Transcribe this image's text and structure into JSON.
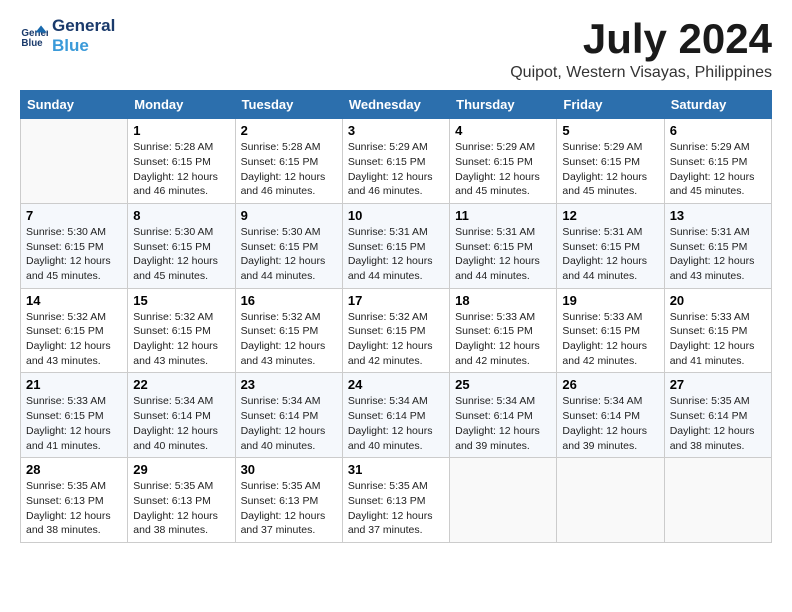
{
  "header": {
    "logo_line1": "General",
    "logo_line2": "Blue",
    "month_year": "July 2024",
    "location": "Quipot, Western Visayas, Philippines"
  },
  "columns": [
    "Sunday",
    "Monday",
    "Tuesday",
    "Wednesday",
    "Thursday",
    "Friday",
    "Saturday"
  ],
  "weeks": [
    [
      {
        "day": "",
        "info": ""
      },
      {
        "day": "1",
        "info": "Sunrise: 5:28 AM\nSunset: 6:15 PM\nDaylight: 12 hours\nand 46 minutes."
      },
      {
        "day": "2",
        "info": "Sunrise: 5:28 AM\nSunset: 6:15 PM\nDaylight: 12 hours\nand 46 minutes."
      },
      {
        "day": "3",
        "info": "Sunrise: 5:29 AM\nSunset: 6:15 PM\nDaylight: 12 hours\nand 46 minutes."
      },
      {
        "day": "4",
        "info": "Sunrise: 5:29 AM\nSunset: 6:15 PM\nDaylight: 12 hours\nand 45 minutes."
      },
      {
        "day": "5",
        "info": "Sunrise: 5:29 AM\nSunset: 6:15 PM\nDaylight: 12 hours\nand 45 minutes."
      },
      {
        "day": "6",
        "info": "Sunrise: 5:29 AM\nSunset: 6:15 PM\nDaylight: 12 hours\nand 45 minutes."
      }
    ],
    [
      {
        "day": "7",
        "info": "Sunrise: 5:30 AM\nSunset: 6:15 PM\nDaylight: 12 hours\nand 45 minutes."
      },
      {
        "day": "8",
        "info": "Sunrise: 5:30 AM\nSunset: 6:15 PM\nDaylight: 12 hours\nand 45 minutes."
      },
      {
        "day": "9",
        "info": "Sunrise: 5:30 AM\nSunset: 6:15 PM\nDaylight: 12 hours\nand 44 minutes."
      },
      {
        "day": "10",
        "info": "Sunrise: 5:31 AM\nSunset: 6:15 PM\nDaylight: 12 hours\nand 44 minutes."
      },
      {
        "day": "11",
        "info": "Sunrise: 5:31 AM\nSunset: 6:15 PM\nDaylight: 12 hours\nand 44 minutes."
      },
      {
        "day": "12",
        "info": "Sunrise: 5:31 AM\nSunset: 6:15 PM\nDaylight: 12 hours\nand 44 minutes."
      },
      {
        "day": "13",
        "info": "Sunrise: 5:31 AM\nSunset: 6:15 PM\nDaylight: 12 hours\nand 43 minutes."
      }
    ],
    [
      {
        "day": "14",
        "info": "Sunrise: 5:32 AM\nSunset: 6:15 PM\nDaylight: 12 hours\nand 43 minutes."
      },
      {
        "day": "15",
        "info": "Sunrise: 5:32 AM\nSunset: 6:15 PM\nDaylight: 12 hours\nand 43 minutes."
      },
      {
        "day": "16",
        "info": "Sunrise: 5:32 AM\nSunset: 6:15 PM\nDaylight: 12 hours\nand 43 minutes."
      },
      {
        "day": "17",
        "info": "Sunrise: 5:32 AM\nSunset: 6:15 PM\nDaylight: 12 hours\nand 42 minutes."
      },
      {
        "day": "18",
        "info": "Sunrise: 5:33 AM\nSunset: 6:15 PM\nDaylight: 12 hours\nand 42 minutes."
      },
      {
        "day": "19",
        "info": "Sunrise: 5:33 AM\nSunset: 6:15 PM\nDaylight: 12 hours\nand 42 minutes."
      },
      {
        "day": "20",
        "info": "Sunrise: 5:33 AM\nSunset: 6:15 PM\nDaylight: 12 hours\nand 41 minutes."
      }
    ],
    [
      {
        "day": "21",
        "info": "Sunrise: 5:33 AM\nSunset: 6:15 PM\nDaylight: 12 hours\nand 41 minutes."
      },
      {
        "day": "22",
        "info": "Sunrise: 5:34 AM\nSunset: 6:14 PM\nDaylight: 12 hours\nand 40 minutes."
      },
      {
        "day": "23",
        "info": "Sunrise: 5:34 AM\nSunset: 6:14 PM\nDaylight: 12 hours\nand 40 minutes."
      },
      {
        "day": "24",
        "info": "Sunrise: 5:34 AM\nSunset: 6:14 PM\nDaylight: 12 hours\nand 40 minutes."
      },
      {
        "day": "25",
        "info": "Sunrise: 5:34 AM\nSunset: 6:14 PM\nDaylight: 12 hours\nand 39 minutes."
      },
      {
        "day": "26",
        "info": "Sunrise: 5:34 AM\nSunset: 6:14 PM\nDaylight: 12 hours\nand 39 minutes."
      },
      {
        "day": "27",
        "info": "Sunrise: 5:35 AM\nSunset: 6:14 PM\nDaylight: 12 hours\nand 38 minutes."
      }
    ],
    [
      {
        "day": "28",
        "info": "Sunrise: 5:35 AM\nSunset: 6:13 PM\nDaylight: 12 hours\nand 38 minutes."
      },
      {
        "day": "29",
        "info": "Sunrise: 5:35 AM\nSunset: 6:13 PM\nDaylight: 12 hours\nand 38 minutes."
      },
      {
        "day": "30",
        "info": "Sunrise: 5:35 AM\nSunset: 6:13 PM\nDaylight: 12 hours\nand 37 minutes."
      },
      {
        "day": "31",
        "info": "Sunrise: 5:35 AM\nSunset: 6:13 PM\nDaylight: 12 hours\nand 37 minutes."
      },
      {
        "day": "",
        "info": ""
      },
      {
        "day": "",
        "info": ""
      },
      {
        "day": "",
        "info": ""
      }
    ]
  ]
}
